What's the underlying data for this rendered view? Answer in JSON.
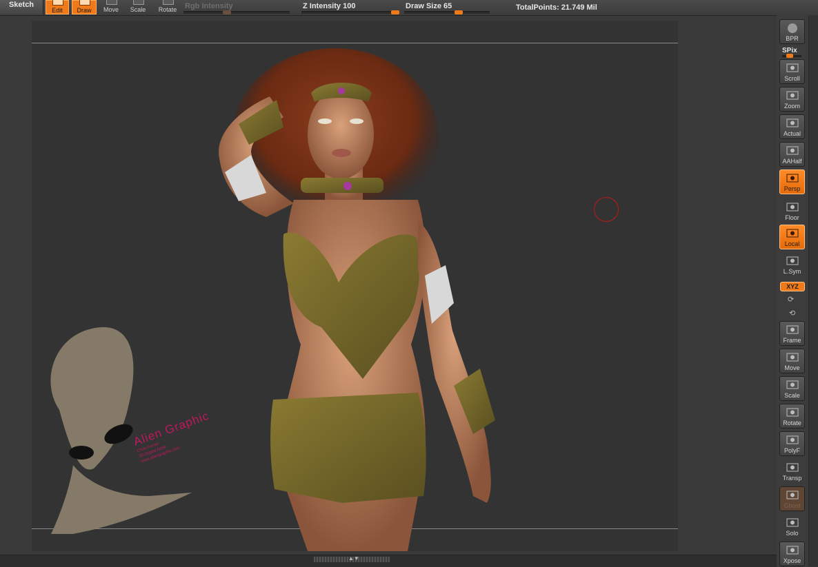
{
  "toolbar": {
    "sketch_label": "Sketch",
    "buttons": [
      {
        "label": "Edit",
        "active": true
      },
      {
        "label": "Draw",
        "active": true
      },
      {
        "label": "Move",
        "active": false
      },
      {
        "label": "Scale",
        "active": false
      },
      {
        "label": "Rotate",
        "active": false
      }
    ],
    "rgb_intensity_label": "Rgb Intensity",
    "z_intensity_label": "Z Intensity",
    "z_intensity_value": "100",
    "draw_size_label": "Draw Size",
    "draw_size_value": "65",
    "total_points": "TotalPoints: 21.749 Mil"
  },
  "sliders": {
    "rgb_intensity_level": 0.4,
    "z_intensity_level": 1.0,
    "draw_size_level": 0.65
  },
  "right_shelf": {
    "bpr_label": "BPR",
    "spix_label": "SPix",
    "buttons": [
      {
        "label": "Scroll",
        "icon": "hand-scroll-icon",
        "active": false
      },
      {
        "label": "Zoom",
        "icon": "magnifier-zoom-icon",
        "active": false
      },
      {
        "label": "Actual",
        "icon": "magnifier-actual-icon",
        "active": false
      },
      {
        "label": "AAHalf",
        "icon": "magnifier-aahalf-icon",
        "active": false
      },
      {
        "label": "Persp",
        "icon": "perspective-grid-icon",
        "active": true
      },
      {
        "label": "Floor",
        "icon": "floor-icon",
        "active": false
      },
      {
        "label": "Local",
        "icon": "local-pivot-icon",
        "active": true
      },
      {
        "label": "L.Sym",
        "icon": "local-symmetry-icon",
        "active": false
      },
      {
        "label": "Frame",
        "icon": "frame-icon",
        "active": false
      },
      {
        "label": "Move",
        "icon": "hand-move-icon",
        "active": false
      },
      {
        "label": "Scale",
        "icon": "magnifier-scale-icon",
        "active": false
      },
      {
        "label": "Rotate",
        "icon": "rotate-icon",
        "active": false
      },
      {
        "label": "PolyF",
        "icon": "polyframe-grid-icon",
        "active": false
      },
      {
        "label": "Transp",
        "icon": "transparency-icon",
        "active": false
      },
      {
        "label": "Ghost",
        "icon": "ghost-icon",
        "active": false,
        "disabled": true
      },
      {
        "label": "Solo",
        "icon": "solo-icon",
        "active": false
      },
      {
        "label": "Xpose",
        "icon": "xpose-icon",
        "active": false
      }
    ],
    "xyz_label": "XYZ"
  },
  "watermark": {
    "title": "Alien Graphic",
    "line1": "Chris Ferrari",
    "line2": "3D Digital Artist",
    "line3": "www.aliengraphic.com"
  },
  "colors": {
    "accent": "#f07a1a",
    "canvas": "#333333",
    "brush_cursor": "#c01818",
    "watermark_text": "#c2185b"
  }
}
